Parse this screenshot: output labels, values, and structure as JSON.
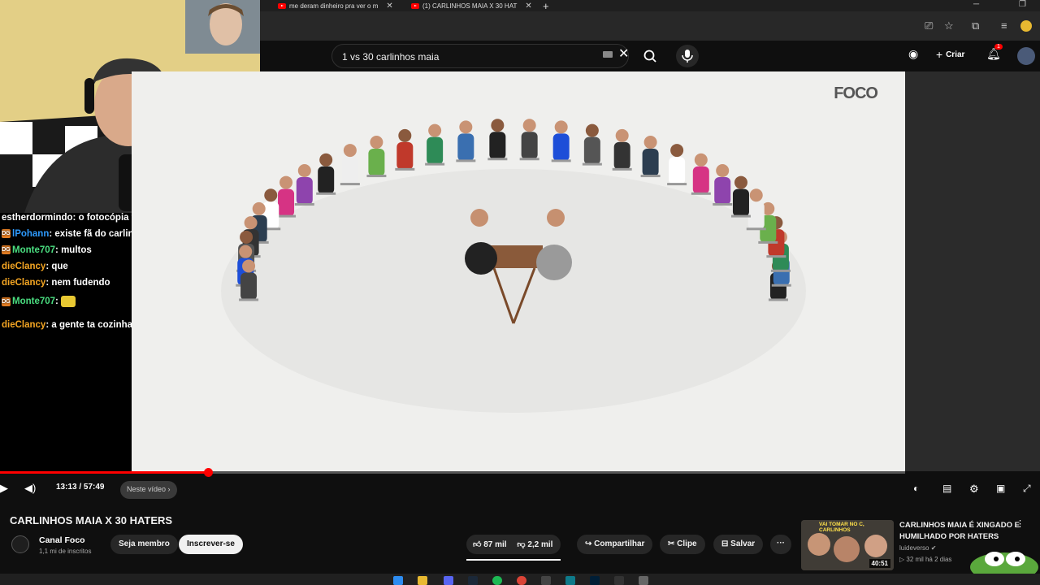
{
  "browser": {
    "tabs": [
      {
        "title": "me deram dinheiro pra ver o m"
      },
      {
        "title": "(1) CARLINHOS MAIA X 30 HAT"
      }
    ],
    "new_tab_label": "+",
    "close_label": "✕"
  },
  "youtube_header": {
    "search_value": "1 vs 30 carlinhos maia",
    "create_label": "Criar",
    "notification_count": "1"
  },
  "stream_chat": {
    "messages": [
      {
        "user": "estherdormindo",
        "badge": "",
        "color": "#ffffff",
        "text": "o fotocópia foi eu acho"
      },
      {
        "user": "lPohann",
        "badge": "DG",
        "color": "#2e9bff",
        "text": "existe fã do carlinhos maia?"
      },
      {
        "user": "Monte707",
        "badge": "DG",
        "color": "#4ade80",
        "text": "multos"
      },
      {
        "user": "dieClancy",
        "badge": "",
        "color": "#f5a623",
        "text": "que"
      },
      {
        "user": "dieClancy",
        "badge": "",
        "color": "#f5a623",
        "text": "nem fudendo"
      },
      {
        "user": "Monte707",
        "badge": "DG",
        "color": "#4ade80",
        "text": ""
      },
      {
        "user": "dieClancy",
        "badge": "",
        "color": "#f5a623",
        "text": "a gente ta cozinhado"
      }
    ]
  },
  "video": {
    "watermark": "FOCO",
    "progress_fraction": 0.2296,
    "time_current": "13:13",
    "time_separator": " / ",
    "time_total": "57:49",
    "chapter_label": "Neste vídeo",
    "title": "CARLINHOS MAIA X 30 HATERS"
  },
  "channel": {
    "name": "Canal Foco",
    "subscribers": "1,1 mi de inscritos",
    "join_label": "Seja membro",
    "subscribe_label": "Inscrever-se"
  },
  "actions": {
    "likes": "87 mil",
    "dislikes": "2,2 mil",
    "share": "Compartilhar",
    "clip": "Clipe",
    "save": "Salvar",
    "more": "···"
  },
  "recommended": {
    "thumb_text": "VAI TOMAR NO C, CARLINHOS",
    "duration": "40:51",
    "title": "CARLINHOS MAIA É XINGADO E HUMILHADO POR HATERS",
    "channel": "luideverso",
    "stats": "32 mil  há 2 dias"
  },
  "colors": {
    "accent": "#ff0000",
    "background": "#0f0f0f",
    "pill": "#272727"
  }
}
